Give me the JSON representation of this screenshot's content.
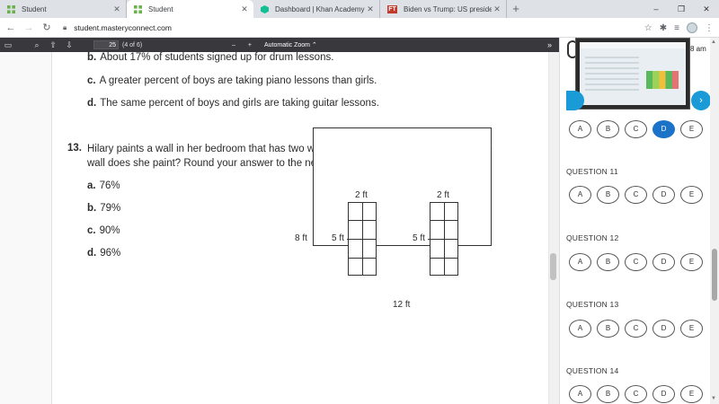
{
  "tabs": [
    {
      "title": "Student",
      "icon": "mastery-icon",
      "active": false
    },
    {
      "title": "Student",
      "icon": "mastery-icon",
      "active": true
    },
    {
      "title": "Dashboard | Khan Academy",
      "icon": "khan-icon",
      "active": false
    },
    {
      "title": "Biden vs Trump: US presidential e",
      "icon": "ft-icon",
      "active": false
    }
  ],
  "ft_favicon_text": "FT",
  "new_tab": "+",
  "window_controls": {
    "minimize": "–",
    "maximize": "❐",
    "close": "✕"
  },
  "address": {
    "url": "student.masteryconnect.com"
  },
  "pdf_toolbar": {
    "page_number": "25",
    "page_count": "(4 of 6)",
    "zoom_out": "–",
    "zoom_in": "+",
    "zoom": "Automatic Zoom",
    "zoom_caret": "⌃",
    "more": "»"
  },
  "document": {
    "prev_b_letter": "b.",
    "prev_b_text": "About 17% of students signed up for drum lessons.",
    "prev_c_letter": "c.",
    "prev_c_text": "A greater percent of boys are taking piano lessons than girls.",
    "prev_d_letter": "d.",
    "prev_d_text": "The same percent of boys and girls are taking guitar lessons.",
    "q13_number": "13.",
    "q13_line1": "Hilary paints a wall in her bedroom that has two windows, as shown. What percent of the",
    "q13_line2": "wall does she paint? Round your answer to the nearest whole percent, if necessary.",
    "answers": [
      {
        "letter": "a.",
        "text": "76%"
      },
      {
        "letter": "b.",
        "text": "79%"
      },
      {
        "letter": "c.",
        "text": "90%"
      },
      {
        "letter": "d.",
        "text": "96%"
      }
    ],
    "figure": {
      "wall_height": "8 ft",
      "wall_width": "12 ft",
      "window1_width": "2 ft",
      "window1_height": "5 ft",
      "window2_width": "2 ft",
      "window2_height": "5 ft"
    }
  },
  "side_panel": {
    "time_text": "8 am",
    "next_arrow": "›",
    "questions": [
      {
        "label": "",
        "choices": [
          "A",
          "B",
          "C",
          "D",
          "E"
        ],
        "selected": "D"
      },
      {
        "label": "QUESTION 11",
        "choices": [
          "A",
          "B",
          "C",
          "D",
          "E"
        ],
        "selected": ""
      },
      {
        "label": "QUESTION 12",
        "choices": [
          "A",
          "B",
          "C",
          "D",
          "E"
        ],
        "selected": ""
      },
      {
        "label": "QUESTION 13",
        "choices": [
          "A",
          "B",
          "C",
          "D",
          "E"
        ],
        "selected": ""
      },
      {
        "label": "QUESTION 14",
        "choices": [
          "A",
          "B",
          "C",
          "D",
          "E"
        ],
        "selected": ""
      }
    ]
  }
}
